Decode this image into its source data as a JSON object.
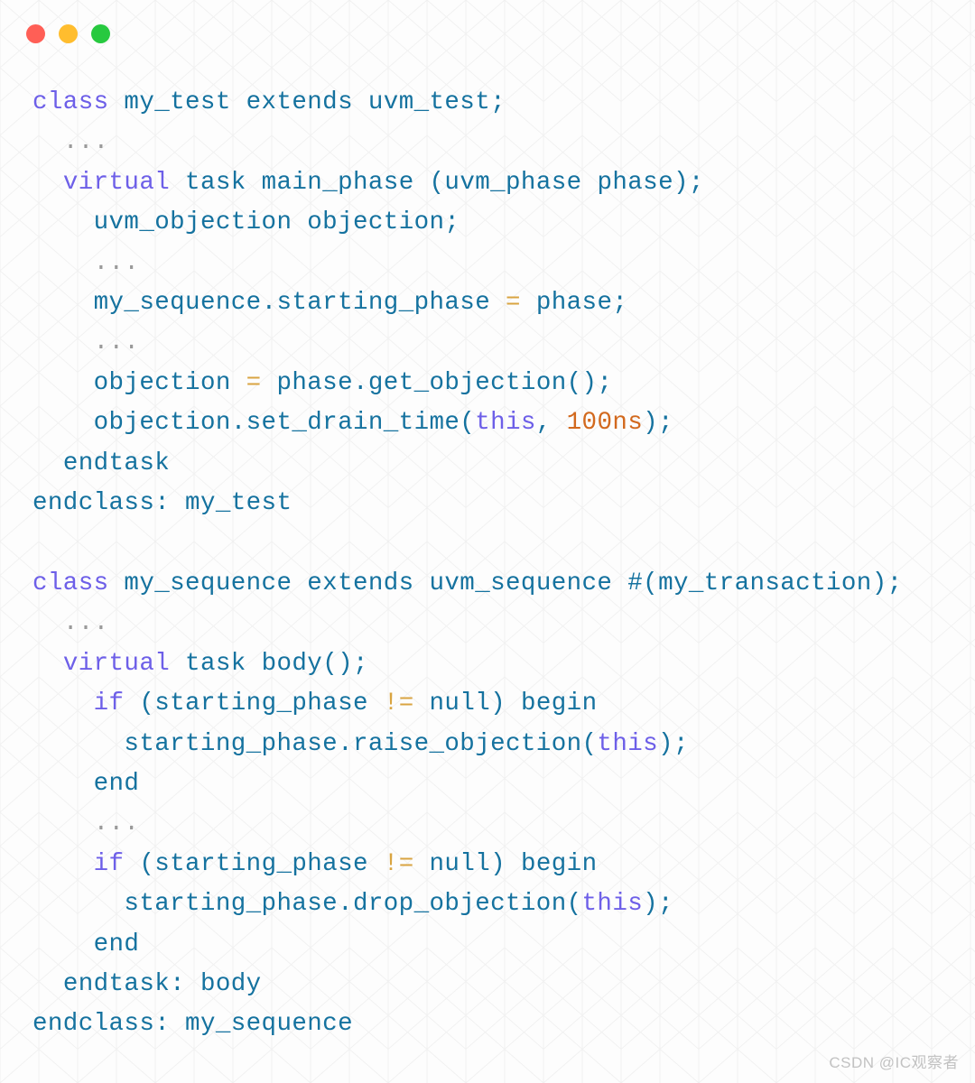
{
  "window": {
    "traffic_lights": [
      {
        "name": "close-button",
        "color": "#ff5f56"
      },
      {
        "name": "minimize-button",
        "color": "#ffbd2e"
      },
      {
        "name": "maximize-button",
        "color": "#27c93f"
      }
    ]
  },
  "theme": {
    "background": "#fdfdfd",
    "keyword": "#6d5fe8",
    "identifier": "#15729f",
    "operator": "#d9a441",
    "number": "#d2691e",
    "ellipsis": "#9a9a9a",
    "grid_line": "#f0f0f0"
  },
  "code": {
    "language": "SystemVerilog / UVM",
    "plain_text": "class my_test extends uvm_test;\n  ...\n  virtual task main_phase (uvm_phase phase);\n    uvm_objection objection;\n    ...\n    my_sequence.starting_phase = phase;\n    ...\n    objection = phase.get_objection();\n    objection.set_drain_time(this, 100ns);\n  endtask\nendclass: my_test\n\nclass my_sequence extends uvm_sequence #(my_transaction);\n  ...\n  virtual task body();\n    if (starting_phase != null) begin\n      starting_phase.raise_objection(this);\n    end\n    ...\n    if (starting_phase != null) begin\n      starting_phase.drop_objection(this);\n    end\n  endtask: body\nendclass: my_sequence",
    "lines": [
      {
        "n": 1,
        "indent": 0,
        "tokens": [
          {
            "t": "class",
            "c": "kw"
          },
          {
            "t": " ",
            "c": "pl"
          },
          {
            "t": "my_test",
            "c": "id"
          },
          {
            "t": " ",
            "c": "pl"
          },
          {
            "t": "extends",
            "c": "id"
          },
          {
            "t": " ",
            "c": "pl"
          },
          {
            "t": "uvm_test",
            "c": "id"
          },
          {
            "t": ";",
            "c": "pun"
          }
        ]
      },
      {
        "n": 2,
        "indent": 2,
        "tokens": [
          {
            "t": "...",
            "c": "dots"
          }
        ]
      },
      {
        "n": 3,
        "indent": 2,
        "tokens": [
          {
            "t": "virtual",
            "c": "kw"
          },
          {
            "t": " ",
            "c": "pl"
          },
          {
            "t": "task",
            "c": "id"
          },
          {
            "t": " ",
            "c": "pl"
          },
          {
            "t": "main_phase",
            "c": "id"
          },
          {
            "t": " ",
            "c": "pl"
          },
          {
            "t": "(",
            "c": "pun"
          },
          {
            "t": "uvm_phase",
            "c": "id"
          },
          {
            "t": " ",
            "c": "pl"
          },
          {
            "t": "phase",
            "c": "id"
          },
          {
            "t": ");",
            "c": "pun"
          }
        ]
      },
      {
        "n": 4,
        "indent": 4,
        "tokens": [
          {
            "t": "uvm_objection",
            "c": "id"
          },
          {
            "t": " ",
            "c": "pl"
          },
          {
            "t": "objection",
            "c": "id"
          },
          {
            "t": ";",
            "c": "pun"
          }
        ]
      },
      {
        "n": 5,
        "indent": 4,
        "tokens": [
          {
            "t": "...",
            "c": "dots"
          }
        ]
      },
      {
        "n": 6,
        "indent": 4,
        "tokens": [
          {
            "t": "my_sequence",
            "c": "id"
          },
          {
            "t": ".",
            "c": "pun"
          },
          {
            "t": "starting_phase",
            "c": "id"
          },
          {
            "t": " ",
            "c": "pl"
          },
          {
            "t": "=",
            "c": "op"
          },
          {
            "t": " ",
            "c": "pl"
          },
          {
            "t": "phase",
            "c": "id"
          },
          {
            "t": ";",
            "c": "pun"
          }
        ]
      },
      {
        "n": 7,
        "indent": 4,
        "tokens": [
          {
            "t": "...",
            "c": "dots"
          }
        ]
      },
      {
        "n": 8,
        "indent": 4,
        "tokens": [
          {
            "t": "objection",
            "c": "id"
          },
          {
            "t": " ",
            "c": "pl"
          },
          {
            "t": "=",
            "c": "op"
          },
          {
            "t": " ",
            "c": "pl"
          },
          {
            "t": "phase",
            "c": "id"
          },
          {
            "t": ".",
            "c": "pun"
          },
          {
            "t": "get_objection",
            "c": "id"
          },
          {
            "t": "();",
            "c": "pun"
          }
        ]
      },
      {
        "n": 9,
        "indent": 4,
        "tokens": [
          {
            "t": "objection",
            "c": "id"
          },
          {
            "t": ".",
            "c": "pun"
          },
          {
            "t": "set_drain_time",
            "c": "id"
          },
          {
            "t": "(",
            "c": "pun"
          },
          {
            "t": "this",
            "c": "kw"
          },
          {
            "t": ", ",
            "c": "pun"
          },
          {
            "t": "100ns",
            "c": "num"
          },
          {
            "t": ");",
            "c": "pun"
          }
        ]
      },
      {
        "n": 10,
        "indent": 2,
        "tokens": [
          {
            "t": "endtask",
            "c": "id"
          }
        ]
      },
      {
        "n": 11,
        "indent": 0,
        "tokens": [
          {
            "t": "endclass",
            "c": "id"
          },
          {
            "t": ": ",
            "c": "pun"
          },
          {
            "t": "my_test",
            "c": "id"
          }
        ]
      },
      {
        "n": 12,
        "indent": 0,
        "tokens": []
      },
      {
        "n": 13,
        "indent": 0,
        "tokens": [
          {
            "t": "class",
            "c": "kw"
          },
          {
            "t": " ",
            "c": "pl"
          },
          {
            "t": "my_sequence",
            "c": "id"
          },
          {
            "t": " ",
            "c": "pl"
          },
          {
            "t": "extends",
            "c": "id"
          },
          {
            "t": " ",
            "c": "pl"
          },
          {
            "t": "uvm_sequence",
            "c": "id"
          },
          {
            "t": " ",
            "c": "pl"
          },
          {
            "t": "#(",
            "c": "pun"
          },
          {
            "t": "my_transaction",
            "c": "id"
          },
          {
            "t": ");",
            "c": "pun"
          }
        ]
      },
      {
        "n": 14,
        "indent": 2,
        "tokens": [
          {
            "t": "...",
            "c": "dots"
          }
        ]
      },
      {
        "n": 15,
        "indent": 2,
        "tokens": [
          {
            "t": "virtual",
            "c": "kw"
          },
          {
            "t": " ",
            "c": "pl"
          },
          {
            "t": "task",
            "c": "id"
          },
          {
            "t": " ",
            "c": "pl"
          },
          {
            "t": "body",
            "c": "id"
          },
          {
            "t": "();",
            "c": "pun"
          }
        ]
      },
      {
        "n": 16,
        "indent": 4,
        "tokens": [
          {
            "t": "if",
            "c": "kw"
          },
          {
            "t": " ",
            "c": "pl"
          },
          {
            "t": "(",
            "c": "pun"
          },
          {
            "t": "starting_phase",
            "c": "id"
          },
          {
            "t": " ",
            "c": "pl"
          },
          {
            "t": "!=",
            "c": "op"
          },
          {
            "t": " ",
            "c": "pl"
          },
          {
            "t": "null",
            "c": "id"
          },
          {
            "t": ")",
            "c": "pun"
          },
          {
            "t": " ",
            "c": "pl"
          },
          {
            "t": "begin",
            "c": "id"
          }
        ]
      },
      {
        "n": 17,
        "indent": 6,
        "tokens": [
          {
            "t": "starting_phase",
            "c": "id"
          },
          {
            "t": ".",
            "c": "pun"
          },
          {
            "t": "raise_objection",
            "c": "id"
          },
          {
            "t": "(",
            "c": "pun"
          },
          {
            "t": "this",
            "c": "kw"
          },
          {
            "t": ");",
            "c": "pun"
          }
        ]
      },
      {
        "n": 18,
        "indent": 4,
        "tokens": [
          {
            "t": "end",
            "c": "id"
          }
        ]
      },
      {
        "n": 19,
        "indent": 4,
        "tokens": [
          {
            "t": "...",
            "c": "dots"
          }
        ]
      },
      {
        "n": 20,
        "indent": 4,
        "tokens": [
          {
            "t": "if",
            "c": "kw"
          },
          {
            "t": " ",
            "c": "pl"
          },
          {
            "t": "(",
            "c": "pun"
          },
          {
            "t": "starting_phase",
            "c": "id"
          },
          {
            "t": " ",
            "c": "pl"
          },
          {
            "t": "!=",
            "c": "op"
          },
          {
            "t": " ",
            "c": "pl"
          },
          {
            "t": "null",
            "c": "id"
          },
          {
            "t": ")",
            "c": "pun"
          },
          {
            "t": " ",
            "c": "pl"
          },
          {
            "t": "begin",
            "c": "id"
          }
        ]
      },
      {
        "n": 21,
        "indent": 6,
        "tokens": [
          {
            "t": "starting_phase",
            "c": "id"
          },
          {
            "t": ".",
            "c": "pun"
          },
          {
            "t": "drop_objection",
            "c": "id"
          },
          {
            "t": "(",
            "c": "pun"
          },
          {
            "t": "this",
            "c": "kw"
          },
          {
            "t": ");",
            "c": "pun"
          }
        ]
      },
      {
        "n": 22,
        "indent": 4,
        "tokens": [
          {
            "t": "end",
            "c": "id"
          }
        ]
      },
      {
        "n": 23,
        "indent": 2,
        "tokens": [
          {
            "t": "endtask",
            "c": "id"
          },
          {
            "t": ": ",
            "c": "pun"
          },
          {
            "t": "body",
            "c": "id"
          }
        ]
      },
      {
        "n": 24,
        "indent": 0,
        "tokens": [
          {
            "t": "endclass",
            "c": "id"
          },
          {
            "t": ": ",
            "c": "pun"
          },
          {
            "t": "my_sequence",
            "c": "id"
          }
        ]
      }
    ]
  },
  "watermark": {
    "text": "CSDN @IC观察者"
  }
}
